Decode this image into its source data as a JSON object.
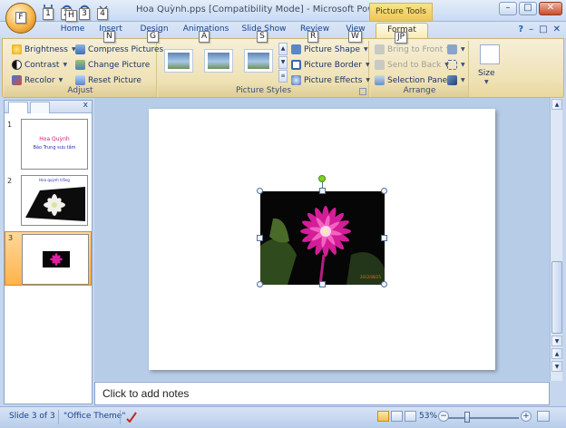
{
  "window": {
    "title": "Hoa Quỳnh.pps [Compatibility Mode] - Microsoft PowerPoint n...",
    "context_tab_label": "Picture Tools",
    "office_keytip": "F",
    "minimize": "–",
    "maximize": "□",
    "close": "✕"
  },
  "qat": [
    {
      "keytip": "1"
    },
    {
      "keytip": "2"
    },
    {
      "keytip": "3"
    },
    {
      "keytip": "4"
    }
  ],
  "tabs": [
    {
      "label": "Home",
      "keytip": "H"
    },
    {
      "label": "Insert",
      "keytip": "N"
    },
    {
      "label": "Design",
      "keytip": "G"
    },
    {
      "label": "Animations",
      "keytip": "A"
    },
    {
      "label": "Slide Show",
      "keytip": "S"
    },
    {
      "label": "Review",
      "keytip": "R"
    },
    {
      "label": "View",
      "keytip": "W"
    },
    {
      "label": "Format",
      "keytip": "JP"
    }
  ],
  "ribbon": {
    "adjust": {
      "label": "Adjust",
      "brightness": "Brightness",
      "contrast": "Contrast",
      "recolor": "Recolor",
      "compress": "Compress Pictures",
      "change": "Change Picture",
      "reset": "Reset Picture"
    },
    "picture_styles": {
      "label": "Picture Styles",
      "shape": "Picture Shape",
      "border": "Picture Border",
      "effects": "Picture Effects"
    },
    "arrange": {
      "label": "Arrange",
      "bring_front": "Bring to Front",
      "send_back": "Send to Back",
      "selection_pane": "Selection Pane"
    },
    "size": {
      "label": "Size"
    }
  },
  "slides_pane": {
    "close": "x",
    "slides": [
      {
        "number": "1",
        "title": "Hoa Quỳnh",
        "subtitle": "Bảo Trung sưu tầm"
      },
      {
        "number": "2",
        "caption": "Hoa quỳnh trắng"
      },
      {
        "number": "3"
      }
    ]
  },
  "photo": {
    "date_stamp": "2012/08/25"
  },
  "notes": {
    "placeholder": "Click to add notes"
  },
  "status": {
    "slide_info": "Slide 3 of 3",
    "theme": "\"Office Theme\"",
    "zoom": "53%",
    "zoom_minus": "−",
    "zoom_plus": "+"
  },
  "colors": {
    "accent": "#15428b",
    "ribbon_bg": "#efe2b6",
    "selected_thumb": "#ffb44a",
    "flower": "#e01fa0"
  }
}
